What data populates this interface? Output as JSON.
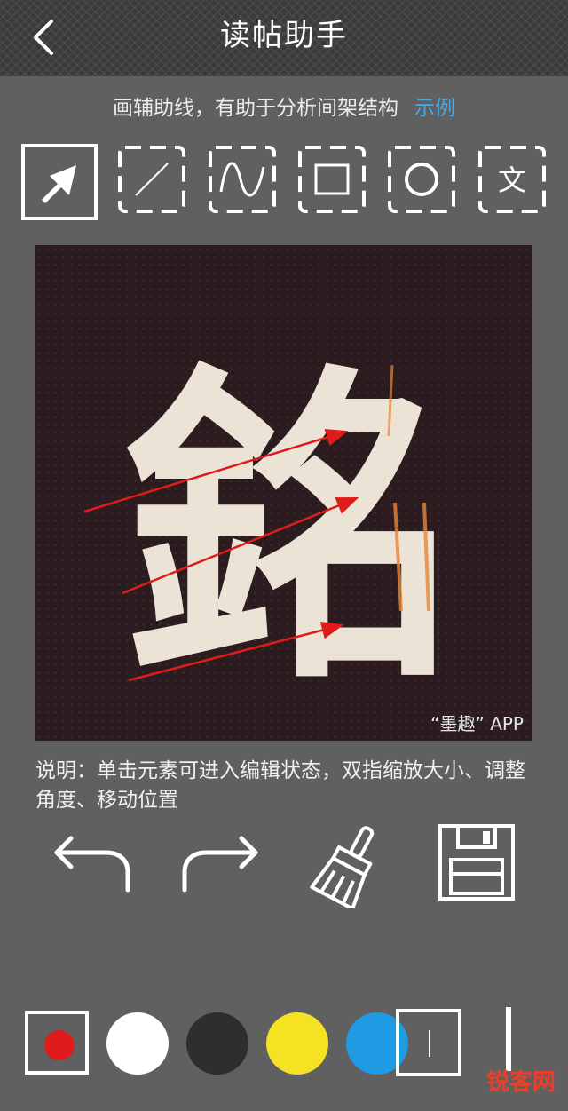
{
  "header": {
    "title": "读帖助手"
  },
  "hint": {
    "text": "画辅助线，有助于分析间架结构",
    "example_link": "示例"
  },
  "tools": [
    {
      "name": "select-tool",
      "icon": "arrow-select-icon",
      "active": true
    },
    {
      "name": "line-tool",
      "icon": "diagonal-line-icon"
    },
    {
      "name": "curve-tool",
      "icon": "wave-curve-icon"
    },
    {
      "name": "rectangle-tool",
      "icon": "rectangle-icon"
    },
    {
      "name": "circle-tool",
      "icon": "circle-icon"
    },
    {
      "name": "text-tool",
      "icon": "text-icon",
      "glyph": "文"
    }
  ],
  "canvas": {
    "calligraphy_char": "銘",
    "watermark": "“墨趣” APP",
    "arrow_color": "#e01b1b"
  },
  "description": "说明：单击元素可进入编辑状态，双指缩放大小、调整角度、移动位置",
  "actions": [
    {
      "name": "undo-button",
      "icon": "undo-arrow-icon"
    },
    {
      "name": "redo-button",
      "icon": "redo-arrow-icon"
    },
    {
      "name": "clear-button",
      "icon": "broom-icon"
    },
    {
      "name": "save-button",
      "icon": "floppy-disk-icon"
    }
  ],
  "colors": {
    "selected": "#e01b1b",
    "swatches": [
      "#ffffff",
      "#2e2e2e",
      "#f5e323",
      "#1e9be2"
    ]
  },
  "brand": {
    "logo_text": "锐客网"
  }
}
